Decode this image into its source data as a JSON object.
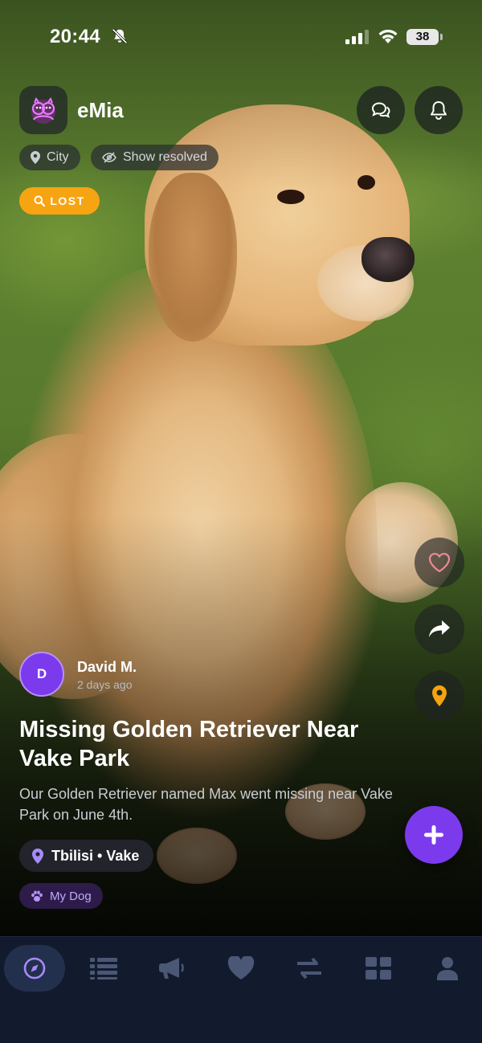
{
  "status_bar": {
    "time": "20:44",
    "battery": "38"
  },
  "header": {
    "app_name": "eMia"
  },
  "filters": {
    "city_label": "City",
    "show_resolved_label": "Show resolved"
  },
  "badge": {
    "label": "LOST",
    "color": "#f7a413"
  },
  "post": {
    "author_initial": "D",
    "author_name": "David M.",
    "posted_ago": "2 days ago",
    "title": "Missing Golden Retriever Near Vake Park",
    "description": "Our Golden Retriever named Max went missing near Vake Park on June 4th.",
    "location": "Tbilisi • Vake",
    "tag": "My Dog"
  },
  "side_actions": [
    "heart-icon",
    "share-icon",
    "map-pin-icon"
  ],
  "bottom_nav": {
    "items": [
      "compass-icon",
      "list-icon",
      "megaphone-icon",
      "heart-icon",
      "swap-icon",
      "grid-icon",
      "profile-icon"
    ],
    "active_index": 0
  },
  "colors": {
    "accent": "#7c3aed",
    "lost": "#f7a413",
    "pin": "#f5a40f",
    "nav_bg": "#121a2e"
  }
}
